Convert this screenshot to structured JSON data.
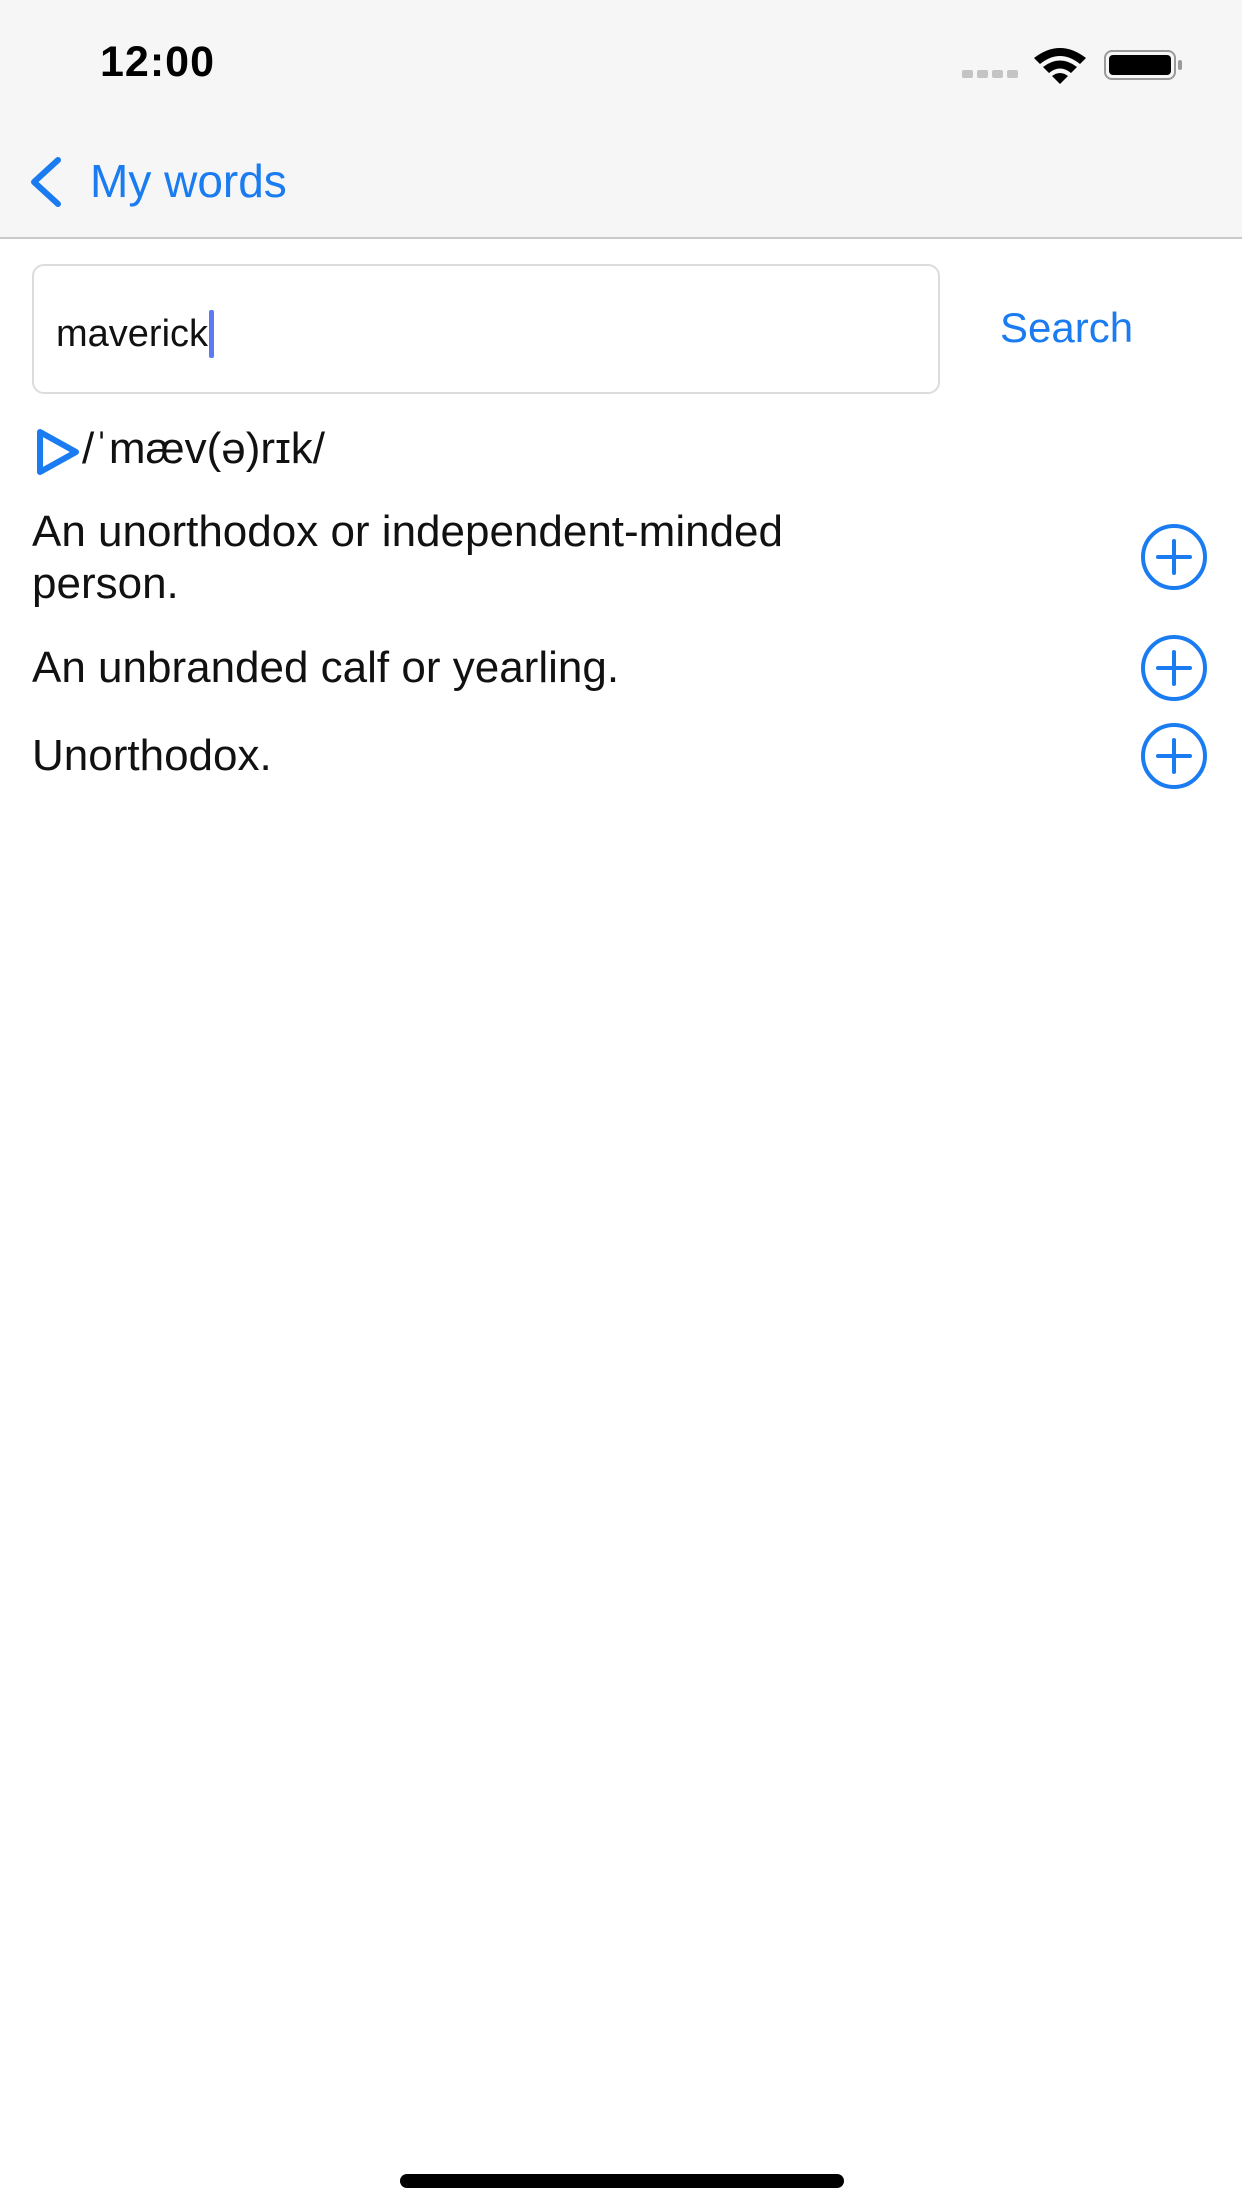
{
  "status_bar": {
    "time": "12:00"
  },
  "nav": {
    "back_label": "My words"
  },
  "search": {
    "value": "maverick",
    "button_label": "Search"
  },
  "entry": {
    "phonetic": "/ˈmæv(ə)rɪk/",
    "meanings": [
      {
        "text": "An unorthodox or independent-minded person."
      },
      {
        "text": "An unbranded calf or yearling."
      },
      {
        "text": "Unorthodox."
      }
    ]
  },
  "colors": {
    "accent": "#1a7cf0",
    "nav_background": "#f6f6f6",
    "text": "#111111"
  },
  "icons": {
    "back": "chevron-left-icon",
    "play": "play-icon",
    "add": "plus-circle-icon",
    "wifi": "wifi-icon",
    "battery": "battery-icon",
    "signal": "cellular-signal-icon"
  }
}
